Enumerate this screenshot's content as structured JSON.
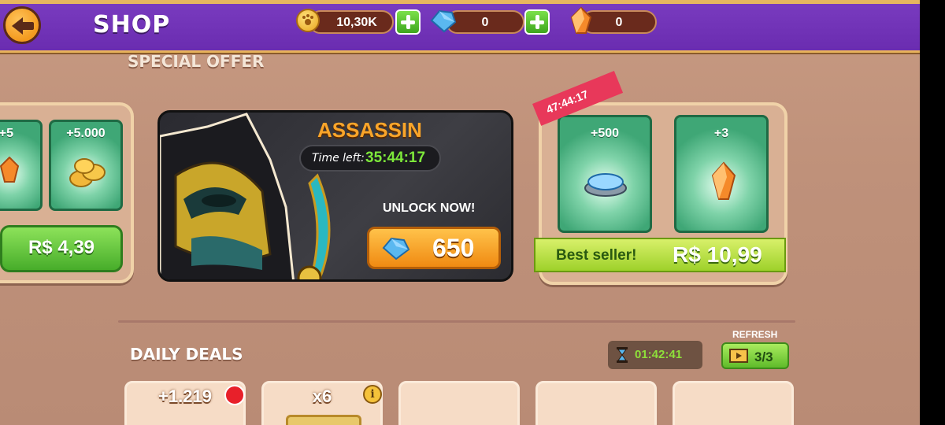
{
  "header": {
    "title": "SHOP",
    "coins": "10,30K",
    "gems": "0",
    "shards": "0"
  },
  "special_offer": {
    "label": "SPECIAL OFFER",
    "left_pack": {
      "card1_amount": "+5",
      "card2_amount": "+5.000",
      "price": "R$ 4,39"
    },
    "assassin": {
      "title": "ASSASSIN",
      "time_label": "Time left:",
      "time_value": "35:44:17",
      "unlock_label": "UNLOCK NOW!",
      "price": "650"
    },
    "bundle": {
      "timer": "47:44:17",
      "card1_amount": "+500",
      "card2_amount": "+3",
      "best_seller": "Best seller!",
      "price": "R$ 10,99"
    }
  },
  "daily_deals": {
    "label": "DAILY DEALS",
    "timer": "01:42:41",
    "refresh_label": "REFRESH",
    "refresh_count": "3/3",
    "deals": [
      {
        "quantity": "+1.219"
      },
      {
        "quantity": "x6"
      },
      {
        "quantity": ""
      },
      {
        "quantity": ""
      },
      {
        "quantity": ""
      }
    ]
  },
  "icons": [
    "back-arrow-icon",
    "paw-coin-icon",
    "plus-icon",
    "gem-icon",
    "shard-icon",
    "coin-stack-icon",
    "gem-tray-icon",
    "hourglass-icon",
    "video-icon",
    "info-icon",
    "notification-dot-icon"
  ]
}
